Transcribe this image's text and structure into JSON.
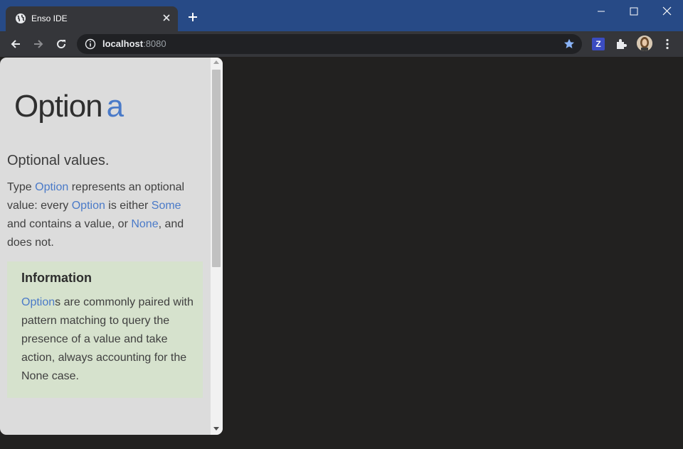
{
  "browser": {
    "tab_title": "Enso IDE",
    "url_host": "localhost",
    "url_port": ":8080",
    "extension_label": "Z"
  },
  "doc": {
    "title_name": "Option",
    "title_param": "a",
    "summary": "Optional values.",
    "desc": {
      "t1": "Type ",
      "l1": "Option",
      "t2": " represents an optional value: every ",
      "l2": "Option",
      "t3": " is either ",
      "l3": "Some",
      "t4": " and contains a value, or ",
      "l4": "None",
      "t5": ", and does not."
    },
    "info": {
      "title": "Information",
      "link": "Option",
      "body": "s are commonly paired with pattern matching to query the presence of a value and take action, always accounting for the None case."
    }
  },
  "colors": {
    "titlebar": "#274a86",
    "toolbar": "#35363a",
    "doc_bg": "#dcdcdc",
    "link": "#4a7ac8",
    "info_bg": "#d6e2cd",
    "canvas": "#222120"
  },
  "icons": [
    "globe-icon",
    "close-icon",
    "plus-icon",
    "minimize-icon",
    "maximize-icon",
    "back-icon",
    "forward-icon",
    "reload-icon",
    "info-icon",
    "star-icon",
    "puzzle-icon",
    "avatar",
    "more-vert-icon"
  ]
}
